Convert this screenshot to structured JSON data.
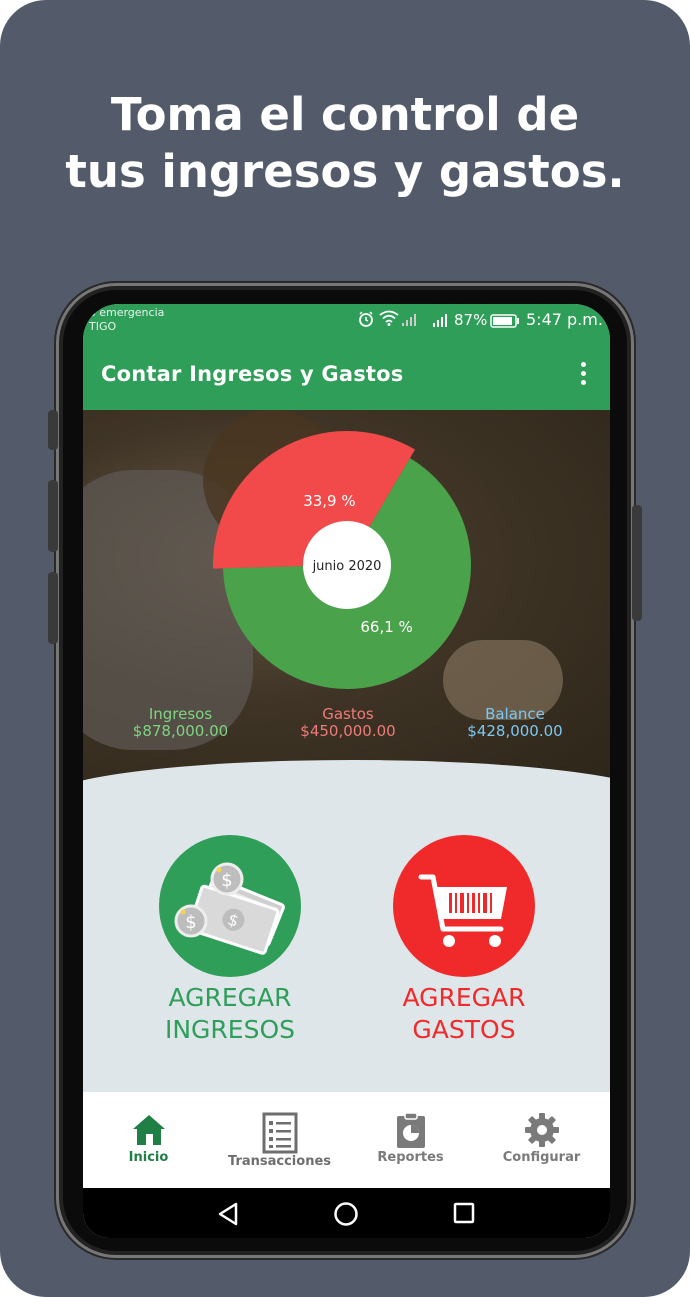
{
  "headline": {
    "line1": "Toma el control de",
    "line2": "tus ingresos y gastos."
  },
  "status_bar": {
    "carrier_line1": "o emergencia",
    "carrier_line2": "TIGO",
    "battery": "87%",
    "time": "5:47 p.m."
  },
  "app_bar": {
    "title": "Contar Ingresos y Gastos",
    "menu_icon": "more-vert-icon"
  },
  "chart_data": {
    "type": "pie",
    "center_label": "junio 2020",
    "slices": [
      {
        "name": "Gastos",
        "value": 33.9,
        "label": "33,9 %",
        "color": "#f24a4a"
      },
      {
        "name": "Ingresos",
        "value": 66.1,
        "label": "66,1 %",
        "color": "#4aa34a"
      }
    ]
  },
  "summary": {
    "ingresos": {
      "label": "Ingresos",
      "value": "$878,000.00",
      "color": "#7fd483"
    },
    "gastos": {
      "label": "Gastos",
      "value": "$450,000.00",
      "color": "#f07a7a"
    },
    "balance": {
      "label": "Balance",
      "value": "$428,000.00",
      "color": "#7cc8f2"
    }
  },
  "actions": {
    "add_income": {
      "line1": "AGREGAR",
      "line2": "INGRESOS",
      "icon": "money-icon",
      "color": "#2e9e58"
    },
    "add_expense": {
      "line1": "AGREGAR",
      "line2": "GASTOS",
      "icon": "shopping-cart-icon",
      "color": "#f02a2a"
    }
  },
  "bottom_nav": [
    {
      "label": "Inicio",
      "icon": "home-icon",
      "active": true
    },
    {
      "label": "Transacciones",
      "icon": "list-icon",
      "active": false
    },
    {
      "label": "Reportes",
      "icon": "report-icon",
      "active": false
    },
    {
      "label": "Configurar",
      "icon": "gear-icon",
      "active": false
    }
  ],
  "colors": {
    "background": "#535b6a",
    "primary": "#2e9e58",
    "expense": "#f02a2a"
  }
}
